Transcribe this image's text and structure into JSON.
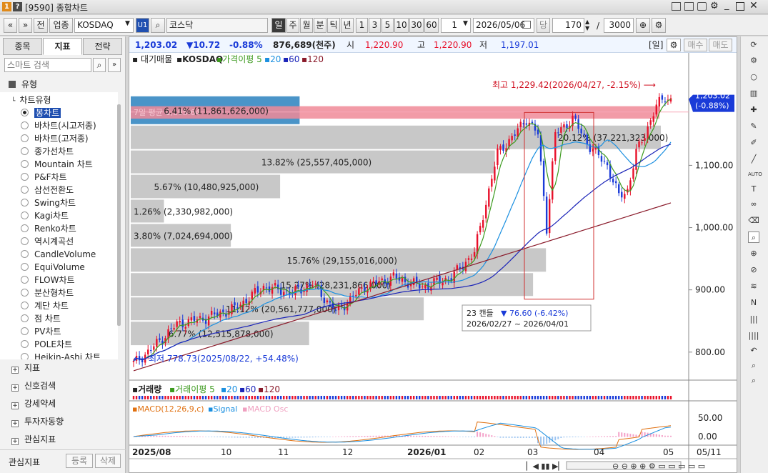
{
  "window": {
    "title": "[9590] 종합차트"
  },
  "toolbar": {
    "jeon": "전",
    "sector": "업종",
    "code": "KOSDAQ",
    "market": "코스닥",
    "periods": [
      "일",
      "주",
      "월",
      "분",
      "틱",
      "년"
    ],
    "numbers": [
      "1",
      "3",
      "5",
      "10",
      "30",
      "60"
    ],
    "interval": "1",
    "date": "2026/05/06",
    "date_mode": "당",
    "count": "170",
    "total": "3000",
    "slash": "/"
  },
  "left": {
    "tabs": [
      "종목",
      "지표",
      "전략"
    ],
    "search_placeholder": "스마트 검색",
    "tree_root": "유형",
    "chart_type_group": "차트유형",
    "chart_types": [
      "봉차트",
      "바차트(시고저종)",
      "바차트(고저종)",
      "종가선차트",
      "Mountain 차트",
      "P&F차트",
      "삼선전환도",
      "Swing차트",
      "Kagi차트",
      "Renko차트",
      "역시계곡선",
      "CandleVolume",
      "EquiVolume",
      "FLOW차트",
      "분산형차트",
      "계단 차트",
      "점 차트",
      "PV차트",
      "POLE차트",
      "Heikin-Ashi 차트"
    ],
    "sections": [
      "지표",
      "신호검색",
      "강세약세",
      "투자자동향",
      "관심지표"
    ],
    "footer_label": "관심지표",
    "register": "등록",
    "delete": "삭제"
  },
  "info": {
    "price": "1,203.02",
    "change": "▼10.72",
    "change_pct": "-0.88%",
    "volume": "876,689(천주)",
    "open_label": "시",
    "open": "1,220.90",
    "high_label": "고",
    "high": "1,220.90",
    "low_label": "저",
    "low": "1,197.01",
    "period_badge": "[일]",
    "buy": "매수",
    "sell": "매도"
  },
  "legend": {
    "volume_profile": "대기매물",
    "series": "KOSDAQ",
    "ma_label": "가격이평",
    "ma": [
      "5",
      "20",
      "60",
      "120"
    ]
  },
  "colors": {
    "up": "#e8102a",
    "down": "#1a3bd8",
    "ma5": "#3c9a1e",
    "ma20": "#1a8fe0",
    "ma60": "#1a23b8",
    "ma120": "#8a1a2a",
    "profile": "#c8c8c8",
    "profile_max": "#4a94c8",
    "highlight": "#f08a98"
  },
  "chart_data": {
    "type": "candlestick",
    "ylim": [
      755,
      1260
    ],
    "yticks": [
      "1,100.00",
      "1,000.00",
      "900.00",
      "800.00"
    ],
    "xticks": [
      "2025/08",
      "10",
      "11",
      "12",
      "2026/01",
      "02",
      "03",
      "04",
      "05",
      "05/11"
    ],
    "current_price_label": "1,203.02",
    "current_change_label": "(-0.88%)",
    "max_label": "최고 1,229.42(2026/04/27, -2.15%)",
    "min_label": "최저 778.73(2025/08/22, +54.48%)",
    "highlight_label": "7일 평균 1,185.64",
    "volume_profile": [
      {
        "label": "6.41% (11,861,626,000)",
        "low": 1165,
        "high": 1212,
        "pct": 6.41
      },
      {
        "label": "20.12% (37,221,323,000)",
        "low": 1125,
        "high": 1165,
        "pct": 20.12
      },
      {
        "label": "13.82% (25,557,405,000)",
        "low": 1086,
        "high": 1125,
        "pct": 13.82
      },
      {
        "label": "5.67% (10,480,925,000)",
        "low": 1046,
        "high": 1086,
        "pct": 5.67
      },
      {
        "label": "1.26% (2,330,982,000)",
        "low": 1007,
        "high": 1046,
        "pct": 1.26
      },
      {
        "label": "3.80% (7,024,694,000)",
        "low": 968,
        "high": 1007,
        "pct": 3.8
      },
      {
        "label": "15.76% (29,155,016,000)",
        "low": 928,
        "high": 968,
        "pct": 15.76
      },
      {
        "label": "15.27% (28,231,866,000)",
        "low": 889,
        "high": 928,
        "pct": 15.27
      },
      {
        "label": "11.12% (20,561,777,000)",
        "low": 850,
        "high": 889,
        "pct": 11.12
      },
      {
        "label": "6.77% (12,515,878,000)",
        "low": 810,
        "high": 850,
        "pct": 6.77
      }
    ],
    "annotation": {
      "label1": "23 캔들",
      "label2": "▼ 76.60 (-6.42%)",
      "label3": "2026/02/27 ~ 2026/04/01"
    },
    "volume_panel": {
      "title": "거래량",
      "ma_label": "거래이평",
      "ma": [
        "5",
        "20",
        "60",
        "120"
      ]
    },
    "macd_panel": {
      "title": "MACD(12,26,9,c)",
      "signal": "Signal",
      "osc": "MACD Osc",
      "yticks": [
        "50.00",
        "0.00"
      ]
    }
  }
}
